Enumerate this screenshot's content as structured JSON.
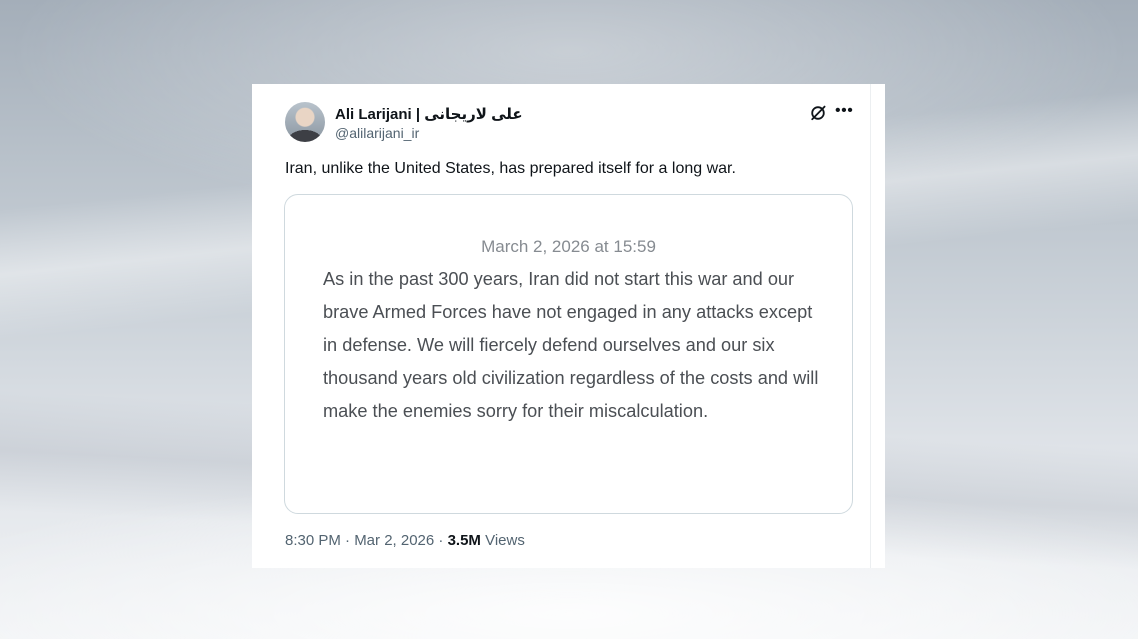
{
  "tweet": {
    "author": {
      "name": "Ali Larijani | علی لاریجانی",
      "handle": "@alilarijani_ir",
      "avatar_icon": "profile-photo"
    },
    "text": "Iran, unlike the United States, has prepared itself for a long war.",
    "quote": {
      "date": "March 2, 2026 at 15:59",
      "body": "As in the past 300 years, Iran did not start this war and our brave Armed Forces have not engaged in any attacks except in defense. We will fiercely defend ourselves and our six thousand years old civilization regardless of the costs and will make the enemies sorry for their miscalculation."
    },
    "meta": {
      "time_date": "8:30 PM · Mar 2, 2026 · ",
      "views_count": "3.5M",
      "views_label": " Views"
    },
    "icons": {
      "grok": "grok-icon",
      "more": "more-options-icon"
    }
  }
}
